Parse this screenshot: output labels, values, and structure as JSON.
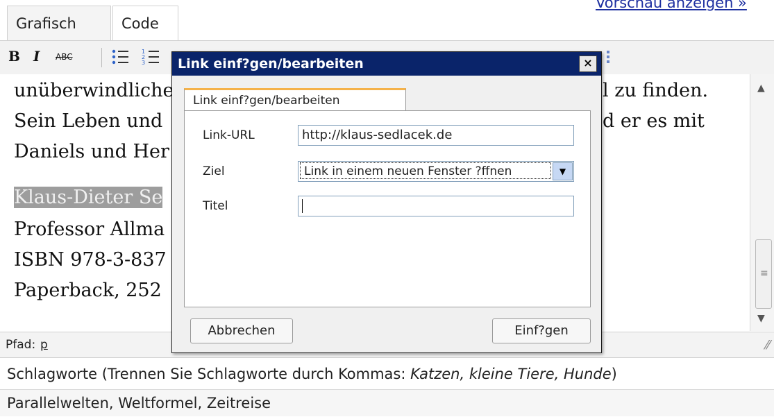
{
  "tabs": {
    "visual": "Grafisch",
    "code": "Code"
  },
  "preview_link": "Vorschau anzeigen »",
  "toolbar": {
    "bold": "B",
    "italic": "I",
    "strikethrough": "ABC"
  },
  "editor": {
    "lines": [
      "unüberwindliche",
      "Sein Leben und",
      "Daniels und Her",
      "Klaus-Dieter Se",
      "Professor Allma",
      "ISBN 978-3-837",
      "Paperback, 252"
    ],
    "right_fragments": [
      "l zu finden.",
      "d er es mit"
    ]
  },
  "path": {
    "label": "Pfad:",
    "value": "p"
  },
  "tags": {
    "hint_prefix": "Schlagworte (Trennen Sie Schlagworte durch Kommas: ",
    "hint_example": "Katzen, kleine Tiere, Hunde",
    "hint_suffix": ")",
    "value": "Parallelwelten, Weltformel, Zeitreise"
  },
  "dialog": {
    "title": "Link einf?gen/bearbeiten",
    "close": "×",
    "tab_label": "Link einf?gen/bearbeiten",
    "url_label": "Link-URL",
    "url_value": "http://klaus-sedlacek.de",
    "target_label": "Ziel",
    "target_value": "Link in einem neuen Fenster ?ffnen",
    "title_label": "Titel",
    "title_value": "",
    "cancel": "Abbrechen",
    "insert": "Einf?gen"
  },
  "colors": {
    "dialog_title_bg": "#0a246a",
    "tab_accent": "#f5b24a",
    "selection_bg": "#9d9d9d",
    "link": "#1d2fa0"
  }
}
